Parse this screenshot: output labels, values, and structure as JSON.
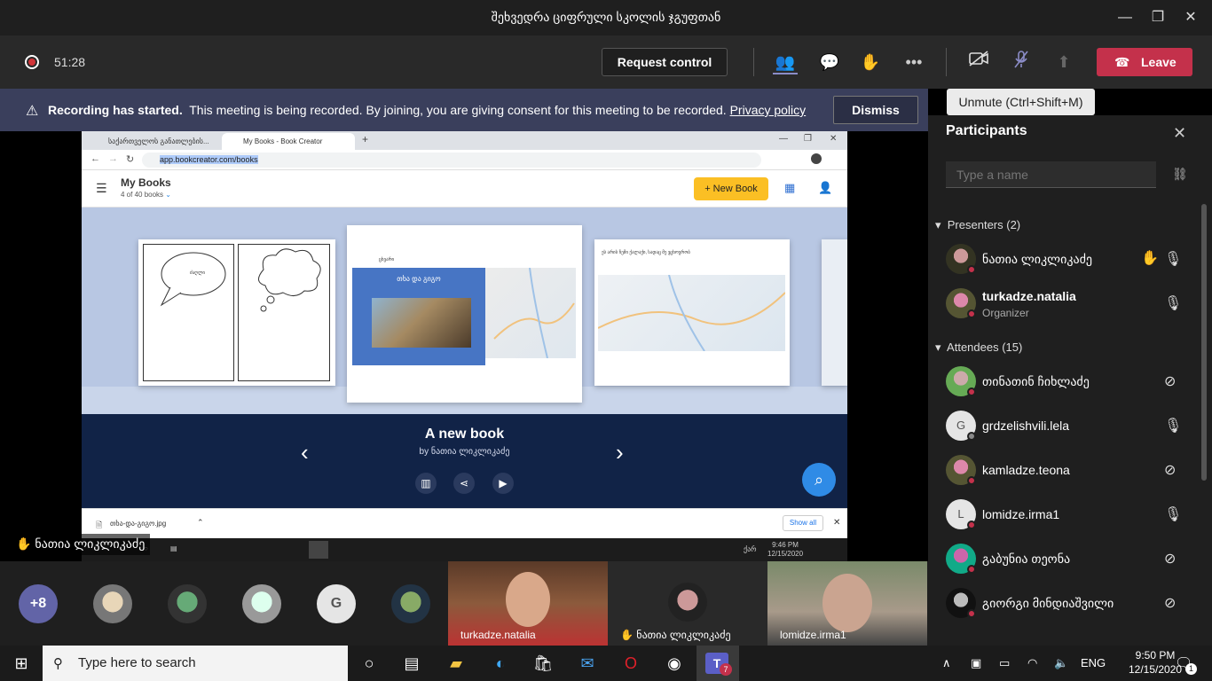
{
  "window": {
    "title": "შეხვედრა ციფრული სკოლის ჯგუფთან"
  },
  "meeting": {
    "timer": "51:28",
    "request_control": "Request control",
    "leave_label": "Leave"
  },
  "banner": {
    "bold": "Recording has started.",
    "text": "This meeting is being recorded. By joining, you are giving consent for this meeting to be recorded.",
    "link": "Privacy policy",
    "dismiss": "Dismiss"
  },
  "tooltip": "Unmute (Ctrl+Shift+M)",
  "shared_screen": {
    "tab1": "საქართველოს განათლების...",
    "tab2": "My Books - Book Creator",
    "url": "app.bookcreator.com/books",
    "app_title": "My Books",
    "book_count": "4 of 40 books",
    "new_book": "+ New Book",
    "page_label_1": "ძაღლი",
    "page_label_2": "ცხვარი",
    "book_cover_title": "თხა და გიგო",
    "map_caption": "ეს არის ჩემი ქალაქი, სადაც მე ვცხოვრობ",
    "selected_book_title": "A new book",
    "selected_book_author": "by ნათია ლიკლიკაძე",
    "download_file": "თხა-და-გიგო.jpg",
    "show_all": "Show all",
    "mini_clock_time": "9:46 PM",
    "mini_clock_date": "12/15/2020",
    "mini_lang": "ქარ"
  },
  "hand_label": "ნათია ლიკლიკაძე",
  "participants": {
    "header": "Participants",
    "search_placeholder": "Type a name",
    "presenters_label": "Presenters (2)",
    "presenters": [
      {
        "name": "ნათია ლიკლიკაძე",
        "role": ""
      },
      {
        "name": "turkadze.natalia",
        "role": "Organizer"
      }
    ],
    "attendees_label": "Attendees (15)",
    "attendees": [
      {
        "name": "თინათინ ჩიხლაძე"
      },
      {
        "name": "grdzelishvili.lela",
        "initial": "G"
      },
      {
        "name": "kamladze.teona"
      },
      {
        "name": "lomidze.irma1",
        "initial": "L"
      },
      {
        "name": "გაბუნია თეონა"
      },
      {
        "name": "გიორგი მინდიაშვილი"
      }
    ]
  },
  "gallery": {
    "more_count": "+8",
    "initial_g": "G",
    "tile1": "turkadze.natalia",
    "tile2": "ნათია ლიკლიკაძე",
    "tile3": "lomidze.irma1"
  },
  "taskbar": {
    "search_placeholder": "Type here to search",
    "lang": "ENG",
    "time": "9:50 PM",
    "date": "12/15/2020",
    "teams_badge": "7",
    "notif_count": "1"
  },
  "colors": {
    "leave": "#c4314b",
    "banner": "#3a3f5c",
    "new_book": "#fbbf24",
    "fab": "#2f8be6"
  }
}
